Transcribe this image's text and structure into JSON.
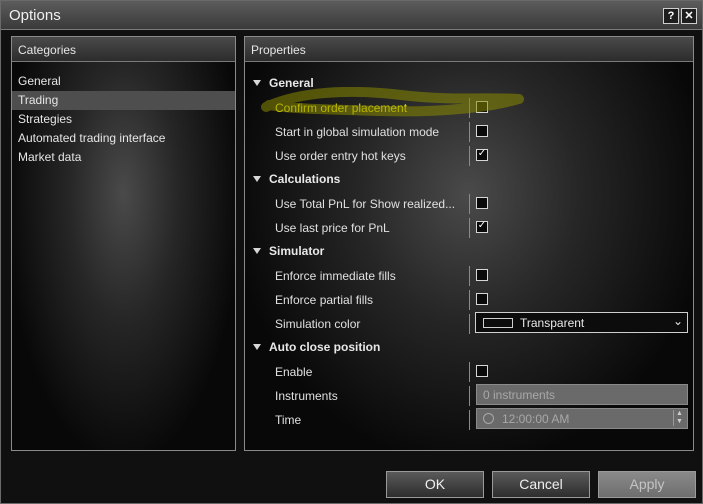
{
  "window": {
    "title": "Options",
    "help_label": "?",
    "close_label": "✕"
  },
  "categories": {
    "header": "Categories",
    "items": [
      {
        "label": "General"
      },
      {
        "label": "Trading"
      },
      {
        "label": "Strategies"
      },
      {
        "label": "Automated trading interface"
      },
      {
        "label": "Market data"
      }
    ],
    "selected": "Trading"
  },
  "properties": {
    "header": "Properties",
    "sections": {
      "general": {
        "label": "General",
        "confirm_order_placement": {
          "label": "Confirm order placement",
          "checked": false
        },
        "start_global_simulation": {
          "label": "Start in global simulation mode",
          "checked": false
        },
        "order_entry_hot_keys": {
          "label": "Use order entry hot keys",
          "checked": true
        }
      },
      "calculations": {
        "label": "Calculations",
        "use_total_pnl": {
          "label": "Use Total PnL for Show realized...",
          "checked": false
        },
        "use_last_price": {
          "label": "Use last price for PnL",
          "checked": true
        }
      },
      "simulator": {
        "label": "Simulator",
        "enforce_immediate_fills": {
          "label": "Enforce immediate fills",
          "checked": false
        },
        "enforce_partial_fills": {
          "label": "Enforce partial fills",
          "checked": false
        },
        "simulation_color": {
          "label": "Simulation color",
          "value": "Transparent",
          "arrow": "⌄"
        }
      },
      "auto_close": {
        "label": "Auto close position",
        "enable": {
          "label": "Enable",
          "checked": false
        },
        "instruments": {
          "label": "Instruments",
          "value": "0 instruments"
        },
        "time": {
          "label": "Time",
          "value": "12:00:00 AM"
        }
      }
    }
  },
  "buttons": {
    "ok": "OK",
    "cancel": "Cancel",
    "apply": "Apply"
  },
  "colors": {
    "highlight_text": "#e6e400",
    "highlight_marker": "#8a8a00"
  }
}
